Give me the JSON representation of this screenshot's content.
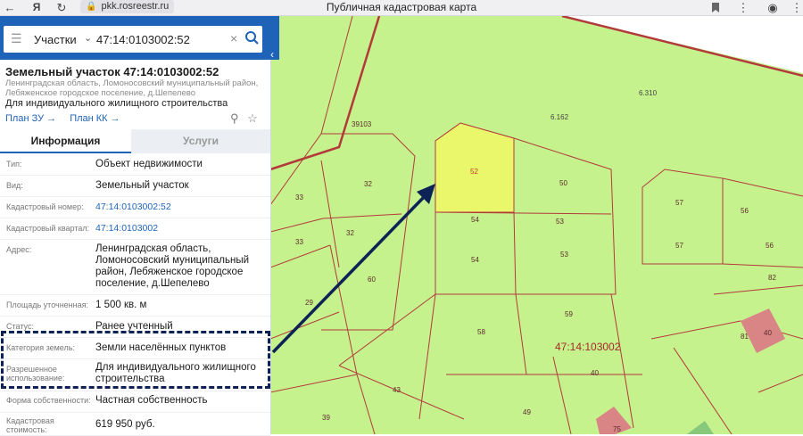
{
  "browser": {
    "url": "pkk.rosreestr.ru",
    "page_title": "Публичная кадастровая карта",
    "back_icon": "←",
    "yandex_icon": "Я",
    "reload_icon": "↻"
  },
  "search": {
    "type_label": "Участки",
    "query": "47:14:0103002:52"
  },
  "parcel": {
    "title": "Земельный участок 47:14:0103002:52",
    "region": "Ленинградская область, Ломоносовский муниципальный район, Лебяженское городское поселение, д.Шепелево",
    "purpose": "Для индивидуального жилищного строительства",
    "plan_zu": "План ЗУ →",
    "plan_kk": "План КК →"
  },
  "tabs": {
    "info": "Информация",
    "services": "Услуги"
  },
  "fields": {
    "type_label": "Тип:",
    "type_value": "Объект недвижимости",
    "kind_label": "Вид:",
    "kind_value": "Земельный участок",
    "cadnum_label": "Кадастровый номер:",
    "cadnum_value": "47:14:0103002:52",
    "quarter_label": "Кадастровый квартал:",
    "quarter_value": "47:14:0103002",
    "address_label": "Адрес:",
    "address_value": "Ленинградская область, Ломоносовский муниципальный район, Лебяженское городское поселение, д.Шепелево",
    "area_label": "Площадь уточненная:",
    "area_value": "1 500 кв. м",
    "status_label": "Статус:",
    "status_value": "Ранее учтенный",
    "category_label": "Категория земель:",
    "category_value": "Земли населённых пунктов",
    "usage_label": "Разрешенное использование:",
    "usage_value": "Для индивидуального жилищного строительства",
    "ownership_label": "Форма собственности:",
    "ownership_value": "Частная собственность",
    "cost_label": "Кадастровая стоимость:",
    "cost_value": "619 950 руб."
  },
  "map": {
    "quarter_label": "47:14:103002",
    "parcel_labels": [
      "52",
      "50",
      "54",
      "53",
      "54",
      "53",
      "33",
      "32",
      "33",
      "32",
      "60",
      "29",
      "59",
      "58",
      "40",
      "43",
      "39",
      "49",
      "57",
      "56",
      "57",
      "56",
      "82",
      "81",
      "40",
      "75",
      "39103"
    ],
    "zone_labels": [
      "6.310",
      "6.162"
    ],
    "colors": {
      "land": "#c6f28d",
      "selected": "#ebf76a",
      "border": "#b23a3a",
      "building": "#d98585",
      "arrow": "#0d2355"
    }
  }
}
